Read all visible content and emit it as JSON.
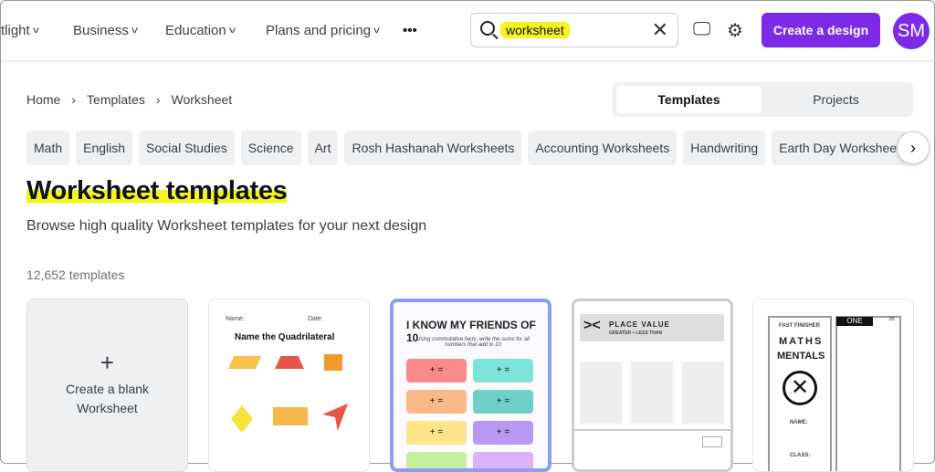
{
  "header": {
    "nav": [
      "tlight",
      "Business",
      "Education",
      "Plans and pricing"
    ],
    "more": "•••",
    "search_value": "worksheet",
    "clear": "✕",
    "create_label": "Create a design",
    "avatar": "SM"
  },
  "breadcrumb": [
    "Home",
    "Templates",
    "Worksheet"
  ],
  "toggle": {
    "templates": "Templates",
    "projects": "Projects",
    "selected": "Templates"
  },
  "chips": [
    "Math",
    "English",
    "Social Studies",
    "Science",
    "Art",
    "Rosh Hashanah Worksheets",
    "Accounting Worksheets",
    "Handwriting",
    "Earth Day Worksheets"
  ],
  "title": "Worksheet templates",
  "subtitle": "Browse high quality Worksheet templates for your next design",
  "count": "12,652 templates",
  "blank": {
    "line1": "Create a blank",
    "line2": "Worksheet"
  },
  "cards": [
    {
      "name": "Name:",
      "date": "Date:",
      "title": "Name the Quadrilateral"
    },
    {
      "title": "I KNOW MY FRIENDS OF 10",
      "sub": "Using commutative facts, write the sums for all numbers that add to 10",
      "eq": "+     ="
    },
    {
      "title": "PLACE VALUE",
      "sub": "GREATER + LESS THAN"
    },
    {
      "label": "FAST FINISHER",
      "title1": "MATHS",
      "title2": "MENTALS",
      "name": "NAME:",
      "class": "CLASS:",
      "one": "ONE",
      "num": "36"
    }
  ],
  "colors": {
    "accent": "#7d2ae8",
    "highlight": "#f5f51e"
  }
}
